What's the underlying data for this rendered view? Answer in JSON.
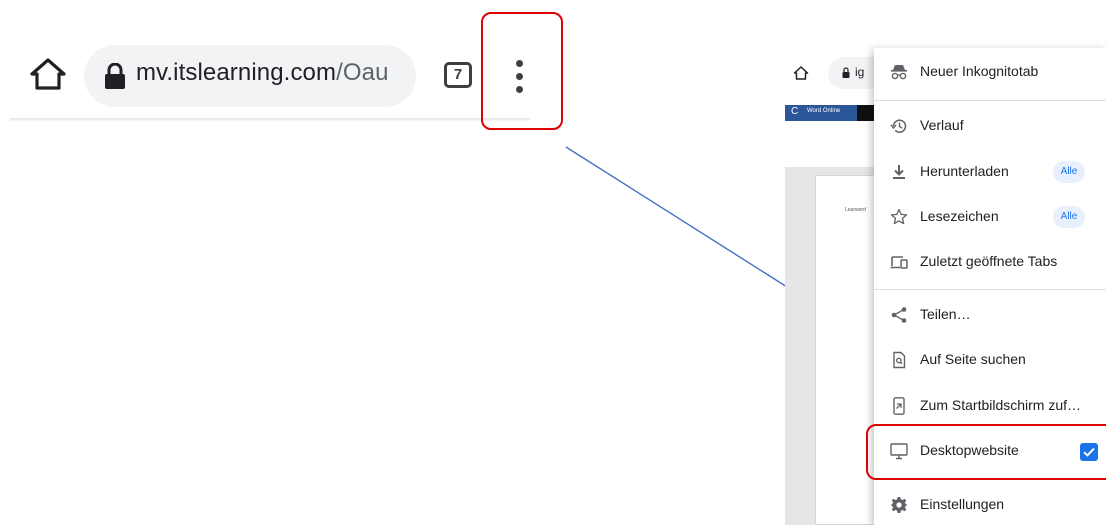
{
  "left_toolbar": {
    "url_host": "mv.itslearning.com",
    "url_path": "/Oau",
    "tab_count": "7"
  },
  "phone": {
    "url_fragment": "ig",
    "word_app_letter": "C",
    "word_app_title": "Word Online",
    "doc_text": "Learword"
  },
  "menu": {
    "items": [
      {
        "label": "Neuer Inkognitotab",
        "icon": "incognito-icon"
      },
      {
        "label": "Verlauf",
        "icon": "history-icon"
      },
      {
        "label": "Herunterladen",
        "icon": "download-icon",
        "pill": "Alle"
      },
      {
        "label": "Lesezeichen",
        "icon": "star-icon",
        "pill": "Alle"
      },
      {
        "label": "Zuletzt geöffnete Tabs",
        "icon": "devices-icon"
      },
      {
        "label": "Teilen…",
        "icon": "share-icon"
      },
      {
        "label": "Auf Seite suchen",
        "icon": "find-in-page-icon"
      },
      {
        "label": "Zum Startbildschirm zuf…",
        "icon": "add-to-home-icon"
      },
      {
        "label": "Desktopwebsite",
        "icon": "desktop-icon",
        "checked": true
      },
      {
        "label": "Einstellungen",
        "icon": "settings-icon"
      }
    ]
  },
  "colors": {
    "highlight": "#e00000",
    "accent": "#1a73e8",
    "arrow": "#4472c4"
  }
}
